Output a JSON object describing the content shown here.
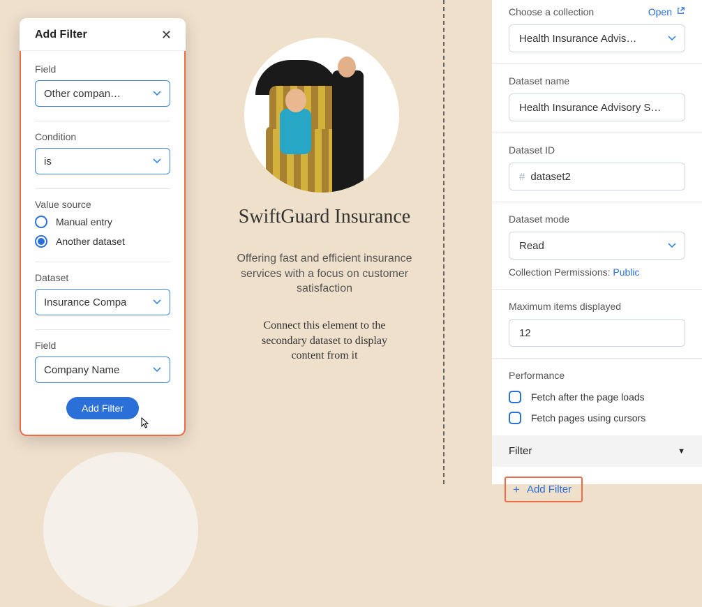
{
  "modal": {
    "title": "Add Filter",
    "labels": {
      "field": "Field",
      "condition": "Condition",
      "value_source": "Value source",
      "dataset": "Dataset",
      "field2": "Field"
    },
    "field_select": "Other compan…",
    "condition_select": "is",
    "radio_manual": "Manual entry",
    "radio_another": "Another dataset",
    "dataset_select": "Insurance Compa",
    "field2_select": "Company Name",
    "submit": "Add Filter"
  },
  "card": {
    "title": "SwiftGuard Insurance",
    "desc": "Offering fast and efficient insurance services with a focus on customer satisfaction",
    "placeholder": "Connect this element to the secondary dataset to display content from it"
  },
  "panel": {
    "collection": {
      "label": "Choose a collection",
      "open": "Open",
      "value": "Health Insurance Advis…"
    },
    "dataset_name": {
      "label": "Dataset name",
      "value": "Health Insurance Advisory S…"
    },
    "dataset_id": {
      "label": "Dataset ID",
      "value": "dataset2"
    },
    "dataset_mode": {
      "label": "Dataset mode",
      "value": "Read",
      "permissions_label": "Collection Permissions:",
      "permissions_value": "Public"
    },
    "max_items": {
      "label": "Maximum items displayed",
      "value": "12"
    },
    "performance": {
      "label": "Performance",
      "fetch_after": "Fetch after the page loads",
      "fetch_cursors": "Fetch pages using cursors"
    },
    "filter": {
      "header": "Filter",
      "add": "Add Filter"
    }
  }
}
